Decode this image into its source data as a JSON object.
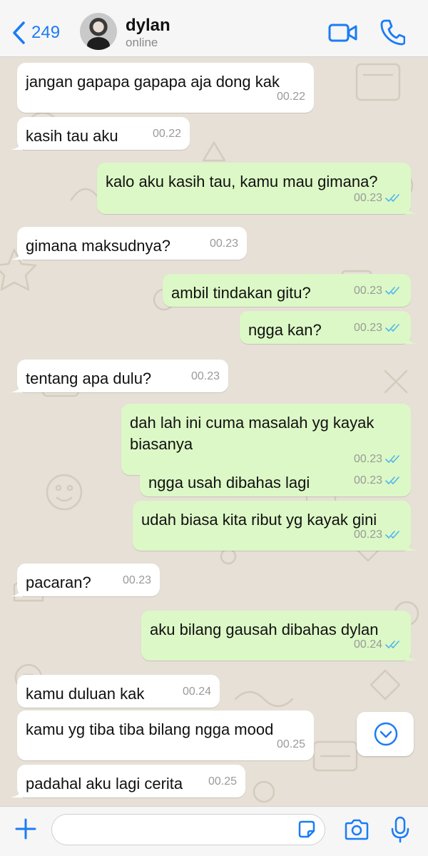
{
  "header": {
    "back_count": "249",
    "contact_name": "dylan",
    "contact_status": "online"
  },
  "messages": [
    {
      "dir": "in",
      "text": "jangan gapapa gapapa aja dong kak",
      "time": "00.22"
    },
    {
      "dir": "in",
      "text": "kasih tau aku",
      "time": "00.22"
    },
    {
      "dir": "out",
      "text": "kalo aku kasih tau, kamu mau gimana?",
      "time": "00.23",
      "status": "read"
    },
    {
      "dir": "in",
      "text": "gimana maksudnya?",
      "time": "00.23"
    },
    {
      "dir": "out",
      "text": "ambil tindakan gitu?",
      "time": "00.23",
      "status": "read"
    },
    {
      "dir": "out",
      "text": "ngga kan?",
      "time": "00.23",
      "status": "read"
    },
    {
      "dir": "in",
      "text": "tentang apa dulu?",
      "time": "00.23"
    },
    {
      "dir": "out",
      "text": "dah lah ini cuma masalah yg kayak biasanya",
      "time": "00.23",
      "status": "read"
    },
    {
      "dir": "out",
      "text": "ngga usah dibahas lagi",
      "time": "00.23",
      "status": "read"
    },
    {
      "dir": "out",
      "text": "udah biasa kita ribut yg kayak gini",
      "time": "00.23",
      "status": "read"
    },
    {
      "dir": "in",
      "text": "pacaran?",
      "time": "00.23"
    },
    {
      "dir": "out",
      "text": "aku bilang gausah dibahas dylan",
      "time": "00.24",
      "status": "read"
    },
    {
      "dir": "in",
      "text": "kamu duluan kak",
      "time": "00.24"
    },
    {
      "dir": "in",
      "text": "kamu yg tiba tiba bilang ngga mood",
      "time": "00.25"
    },
    {
      "dir": "in",
      "text": "padahal aku lagi cerita",
      "time": "00.25"
    }
  ],
  "composer": {
    "value": "",
    "placeholder": ""
  },
  "colors": {
    "accent": "#1a7cf5",
    "outgoing_bubble": "#dcf8c6",
    "incoming_bubble": "#ffffff",
    "read_ticks": "#4fb6ec",
    "wallpaper": "#e6e0d6"
  },
  "icons": [
    "chevron-left-icon",
    "video-camera-icon",
    "phone-icon",
    "chevron-down-icon",
    "plus-icon",
    "sticker-icon",
    "camera-icon",
    "microphone-icon"
  ]
}
